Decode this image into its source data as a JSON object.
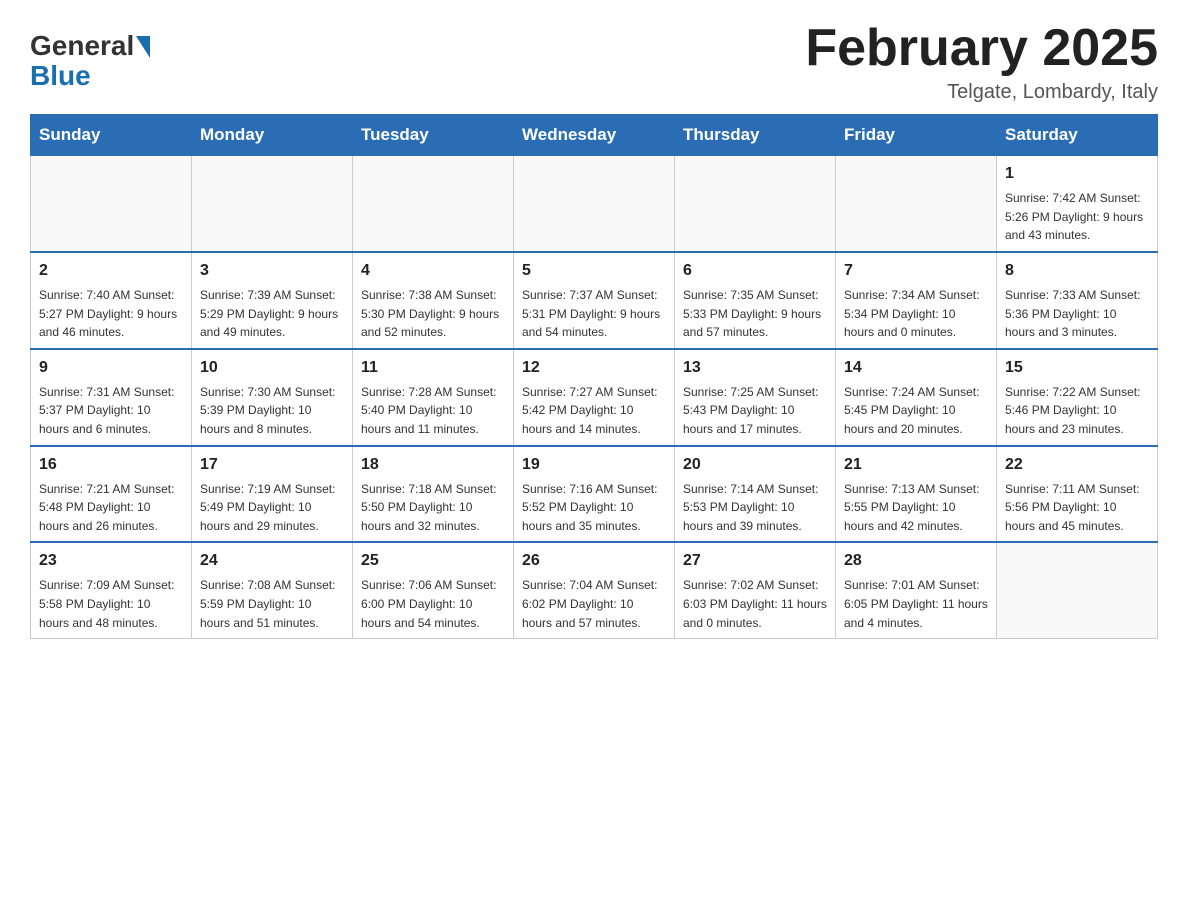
{
  "header": {
    "logo_general": "General",
    "logo_blue": "Blue",
    "title": "February 2025",
    "location": "Telgate, Lombardy, Italy"
  },
  "days_of_week": [
    "Sunday",
    "Monday",
    "Tuesday",
    "Wednesday",
    "Thursday",
    "Friday",
    "Saturday"
  ],
  "weeks": [
    [
      {
        "day": "",
        "info": ""
      },
      {
        "day": "",
        "info": ""
      },
      {
        "day": "",
        "info": ""
      },
      {
        "day": "",
        "info": ""
      },
      {
        "day": "",
        "info": ""
      },
      {
        "day": "",
        "info": ""
      },
      {
        "day": "1",
        "info": "Sunrise: 7:42 AM\nSunset: 5:26 PM\nDaylight: 9 hours\nand 43 minutes."
      }
    ],
    [
      {
        "day": "2",
        "info": "Sunrise: 7:40 AM\nSunset: 5:27 PM\nDaylight: 9 hours\nand 46 minutes."
      },
      {
        "day": "3",
        "info": "Sunrise: 7:39 AM\nSunset: 5:29 PM\nDaylight: 9 hours\nand 49 minutes."
      },
      {
        "day": "4",
        "info": "Sunrise: 7:38 AM\nSunset: 5:30 PM\nDaylight: 9 hours\nand 52 minutes."
      },
      {
        "day": "5",
        "info": "Sunrise: 7:37 AM\nSunset: 5:31 PM\nDaylight: 9 hours\nand 54 minutes."
      },
      {
        "day": "6",
        "info": "Sunrise: 7:35 AM\nSunset: 5:33 PM\nDaylight: 9 hours\nand 57 minutes."
      },
      {
        "day": "7",
        "info": "Sunrise: 7:34 AM\nSunset: 5:34 PM\nDaylight: 10 hours\nand 0 minutes."
      },
      {
        "day": "8",
        "info": "Sunrise: 7:33 AM\nSunset: 5:36 PM\nDaylight: 10 hours\nand 3 minutes."
      }
    ],
    [
      {
        "day": "9",
        "info": "Sunrise: 7:31 AM\nSunset: 5:37 PM\nDaylight: 10 hours\nand 6 minutes."
      },
      {
        "day": "10",
        "info": "Sunrise: 7:30 AM\nSunset: 5:39 PM\nDaylight: 10 hours\nand 8 minutes."
      },
      {
        "day": "11",
        "info": "Sunrise: 7:28 AM\nSunset: 5:40 PM\nDaylight: 10 hours\nand 11 minutes."
      },
      {
        "day": "12",
        "info": "Sunrise: 7:27 AM\nSunset: 5:42 PM\nDaylight: 10 hours\nand 14 minutes."
      },
      {
        "day": "13",
        "info": "Sunrise: 7:25 AM\nSunset: 5:43 PM\nDaylight: 10 hours\nand 17 minutes."
      },
      {
        "day": "14",
        "info": "Sunrise: 7:24 AM\nSunset: 5:45 PM\nDaylight: 10 hours\nand 20 minutes."
      },
      {
        "day": "15",
        "info": "Sunrise: 7:22 AM\nSunset: 5:46 PM\nDaylight: 10 hours\nand 23 minutes."
      }
    ],
    [
      {
        "day": "16",
        "info": "Sunrise: 7:21 AM\nSunset: 5:48 PM\nDaylight: 10 hours\nand 26 minutes."
      },
      {
        "day": "17",
        "info": "Sunrise: 7:19 AM\nSunset: 5:49 PM\nDaylight: 10 hours\nand 29 minutes."
      },
      {
        "day": "18",
        "info": "Sunrise: 7:18 AM\nSunset: 5:50 PM\nDaylight: 10 hours\nand 32 minutes."
      },
      {
        "day": "19",
        "info": "Sunrise: 7:16 AM\nSunset: 5:52 PM\nDaylight: 10 hours\nand 35 minutes."
      },
      {
        "day": "20",
        "info": "Sunrise: 7:14 AM\nSunset: 5:53 PM\nDaylight: 10 hours\nand 39 minutes."
      },
      {
        "day": "21",
        "info": "Sunrise: 7:13 AM\nSunset: 5:55 PM\nDaylight: 10 hours\nand 42 minutes."
      },
      {
        "day": "22",
        "info": "Sunrise: 7:11 AM\nSunset: 5:56 PM\nDaylight: 10 hours\nand 45 minutes."
      }
    ],
    [
      {
        "day": "23",
        "info": "Sunrise: 7:09 AM\nSunset: 5:58 PM\nDaylight: 10 hours\nand 48 minutes."
      },
      {
        "day": "24",
        "info": "Sunrise: 7:08 AM\nSunset: 5:59 PM\nDaylight: 10 hours\nand 51 minutes."
      },
      {
        "day": "25",
        "info": "Sunrise: 7:06 AM\nSunset: 6:00 PM\nDaylight: 10 hours\nand 54 minutes."
      },
      {
        "day": "26",
        "info": "Sunrise: 7:04 AM\nSunset: 6:02 PM\nDaylight: 10 hours\nand 57 minutes."
      },
      {
        "day": "27",
        "info": "Sunrise: 7:02 AM\nSunset: 6:03 PM\nDaylight: 11 hours\nand 0 minutes."
      },
      {
        "day": "28",
        "info": "Sunrise: 7:01 AM\nSunset: 6:05 PM\nDaylight: 11 hours\nand 4 minutes."
      },
      {
        "day": "",
        "info": ""
      }
    ]
  ]
}
